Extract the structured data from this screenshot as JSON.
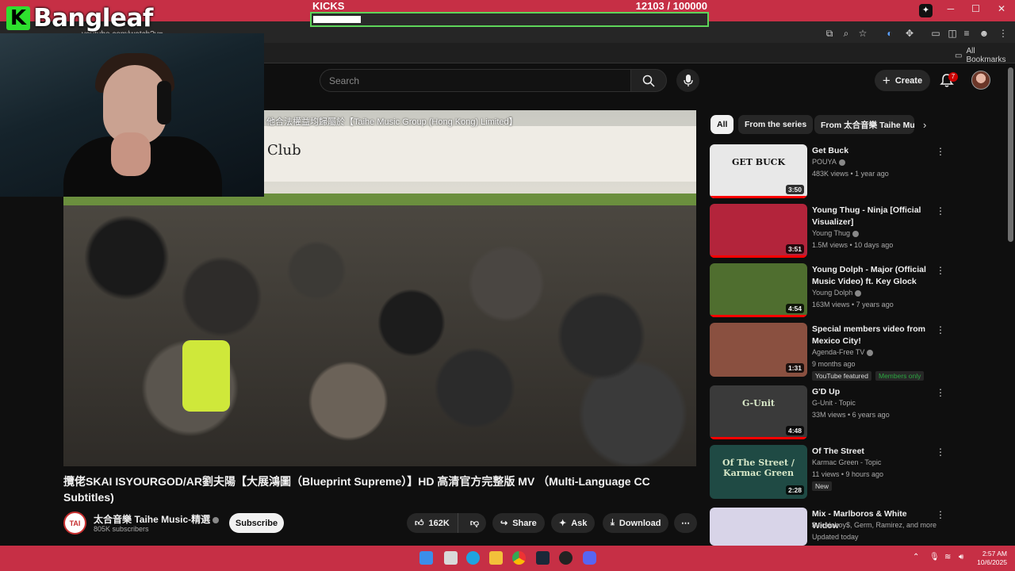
{
  "overlay": {
    "brand": "Bangleaf",
    "brand_mark": "K",
    "kicks_label": "KICKS",
    "kicks_count": "12103",
    "kicks_goal": "/ 100000",
    "kicks_progress": 0.121
  },
  "browser": {
    "url": "youtube.com/watch?v=...",
    "all_bookmarks": "All Bookmarks"
  },
  "header": {
    "search_placeholder": "Search",
    "create_label": "Create",
    "notification_count": "7"
  },
  "video": {
    "caption": "他合法權益均歸屬於【Taihe Music Group (Hong Kong) Limited】",
    "sign_text": "Club",
    "title": "攬佬SKAI ISYOURGOD/AR劉夫陽【大展鴻圖（Blueprint Supreme）】HD 高清官方完整版 MV （Multi-Language CC Subtitles)",
    "channel_avatar_text": "TAI",
    "channel_name": "太合音樂 Taihe Music-精選",
    "subscribers": "805K subscribers",
    "subscribe_label": "Subscribe",
    "likes": "162K",
    "share_label": "Share",
    "ask_label": "Ask",
    "download_label": "Download"
  },
  "chips": {
    "all": "All",
    "series": "From the series",
    "from": "From 太合音樂 Taihe Music"
  },
  "recommendations": [
    {
      "title": "Get Buck",
      "channel": "POUYA",
      "verified": true,
      "meta": "483K views • 1 year ago",
      "duration": "3:50",
      "thumb_text": "GET BUCK",
      "thumb_bg": "#e8e8e8",
      "progress": 1.0
    },
    {
      "title": "Young Thug - Ninja [Official Visualizer]",
      "channel": "Young Thug",
      "verified": true,
      "meta": "1.5M views • 10 days ago",
      "duration": "3:51",
      "thumb_text": "",
      "thumb_bg": "#b3243b",
      "progress": 1.0
    },
    {
      "title": "Young Dolph - Major (Official Music Video) ft. Key Glock",
      "channel": "Young Dolph",
      "verified": true,
      "meta": "163M views • 7 years ago",
      "duration": "4:54",
      "thumb_text": "",
      "thumb_bg": "#4f6e2f",
      "progress": 1.0
    },
    {
      "title": "Special members video from Mexico City!",
      "channel": "Agenda-Free TV",
      "verified": true,
      "meta": "9 months ago",
      "duration": "1:31",
      "thumb_text": "",
      "thumb_bg": "#8a5040",
      "progress": 0,
      "badges": [
        "YouTube featured",
        "Members only"
      ]
    },
    {
      "title": "G'D Up",
      "channel": "G-Unit - Topic",
      "verified": false,
      "meta": "33M views • 6 years ago",
      "duration": "4:48",
      "thumb_text": "G-Unit",
      "thumb_bg": "#3a3a3a",
      "progress": 1.0
    },
    {
      "title": "Of The Street",
      "channel": "Karmac Green - Topic",
      "verified": false,
      "meta": "11 views • 9 hours ago",
      "duration": "2:28",
      "thumb_text": "Of The Street / Karmac Green",
      "thumb_bg": "#1f4a44",
      "progress": 0,
      "badges": [
        "New"
      ]
    },
    {
      "title": "Mix - Marlboros & White Widow",
      "channel": "$uicideboy$, Germ, Ramirez, and more",
      "verified": false,
      "meta": "Updated today",
      "duration": "",
      "thumb_text": "",
      "thumb_bg": "#d8d4e8",
      "progress": 0
    }
  ],
  "taskbar": {
    "time": "2:57 AM",
    "date": "10/6/2025"
  },
  "colors": {
    "overlay_red": "#c62f45",
    "brand_green": "#2ee02e",
    "progress_red": "#ff0000",
    "members_green": "#2ba640"
  }
}
